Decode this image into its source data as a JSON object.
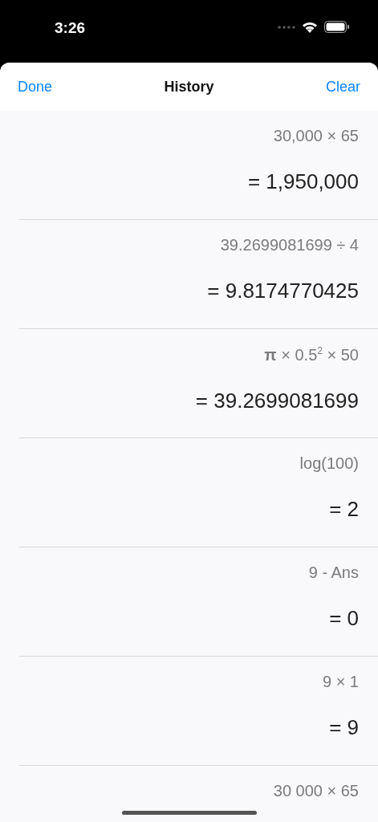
{
  "status_bar": {
    "time": "3:26"
  },
  "header": {
    "left_button": "Done",
    "title": "History",
    "right_button": "Clear"
  },
  "history": [
    {
      "expression": "30,000 × 65",
      "result": "= 1,950,000"
    },
    {
      "expression": "39.2699081699 ÷ 4",
      "result": "= 9.8174770425"
    },
    {
      "expression": "**π** × 0.5$^{2}$ × 50",
      "result": "= 39.2699081699"
    },
    {
      "expression": "log(100)",
      "result": "= 2"
    },
    {
      "expression": "9 - Ans",
      "result": "= 0"
    },
    {
      "expression": "9 × 1",
      "result": "= 9"
    },
    {
      "expression": "30 000 × 65"
    }
  ]
}
